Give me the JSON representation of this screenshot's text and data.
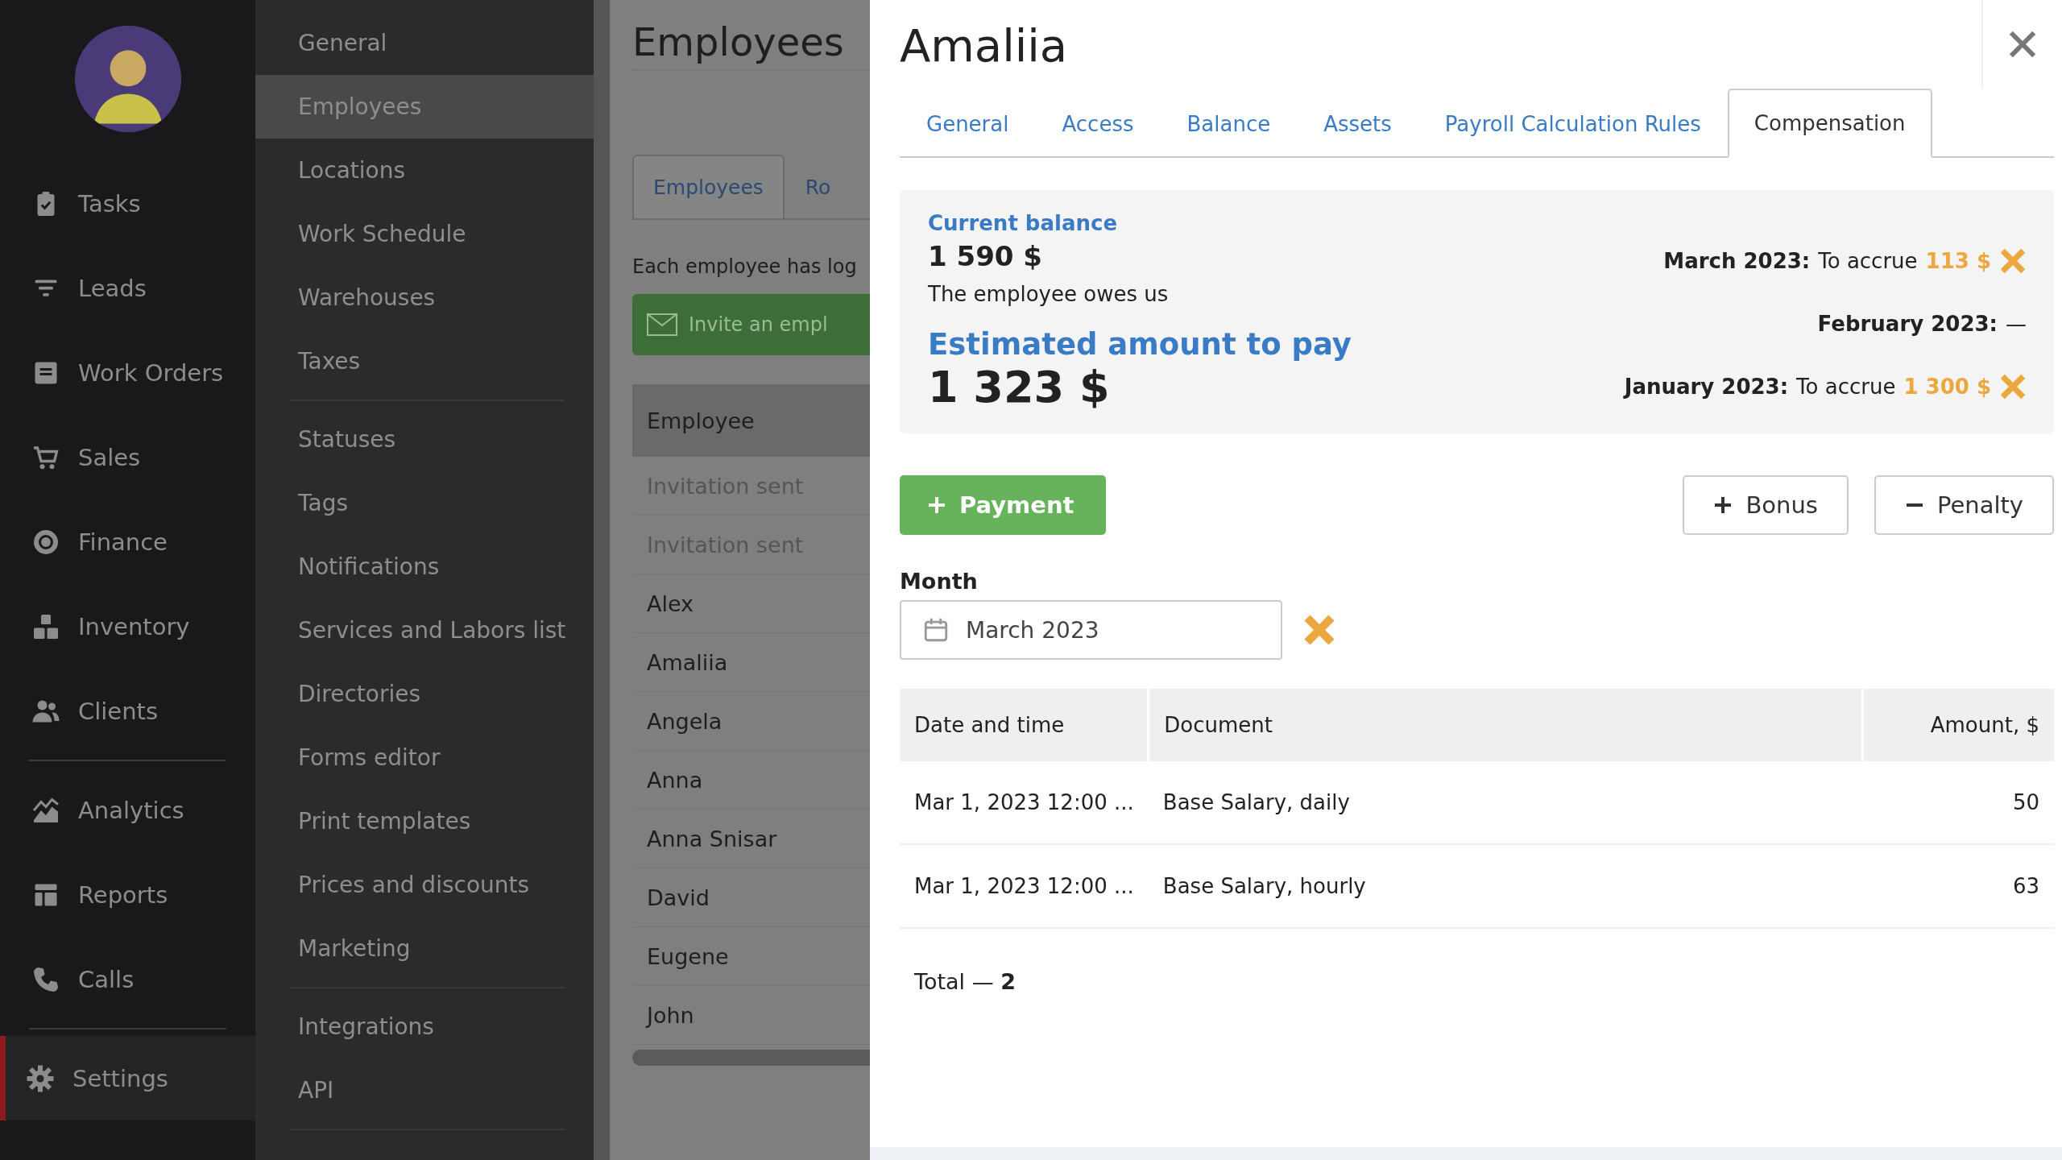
{
  "nav": {
    "groups": [
      [
        {
          "label": "Tasks",
          "selected": false
        },
        {
          "label": "Leads",
          "selected": false
        },
        {
          "label": "Work Orders",
          "selected": false
        },
        {
          "label": "Sales",
          "selected": false
        },
        {
          "label": "Finance",
          "selected": false
        },
        {
          "label": "Inventory",
          "selected": false
        },
        {
          "label": "Clients",
          "selected": false
        }
      ],
      [
        {
          "label": "Analytics",
          "selected": false
        },
        {
          "label": "Reports",
          "selected": false
        },
        {
          "label": "Calls",
          "selected": false
        }
      ],
      [
        {
          "label": "Settings",
          "selected": true
        }
      ]
    ]
  },
  "settings_menu": {
    "groups": [
      [
        {
          "label": "General",
          "selected": false
        },
        {
          "label": "Employees",
          "selected": true
        },
        {
          "label": "Locations",
          "selected": false
        },
        {
          "label": "Work Schedule",
          "selected": false
        },
        {
          "label": "Warehouses",
          "selected": false
        },
        {
          "label": "Taxes",
          "selected": false
        }
      ],
      [
        {
          "label": "Statuses",
          "selected": false
        },
        {
          "label": "Tags",
          "selected": false
        },
        {
          "label": "Notifications",
          "selected": false
        },
        {
          "label": "Services and Labors list",
          "selected": false
        },
        {
          "label": "Directories",
          "selected": false
        },
        {
          "label": "Forms editor",
          "selected": false
        },
        {
          "label": "Print templates",
          "selected": false
        },
        {
          "label": "Prices and discounts",
          "selected": false
        },
        {
          "label": "Marketing",
          "selected": false
        }
      ],
      [
        {
          "label": "Integrations",
          "selected": false
        },
        {
          "label": "API",
          "selected": false
        }
      ]
    ]
  },
  "background_page": {
    "title": "Employees",
    "tabs": [
      {
        "label": "Employees",
        "selected": true
      },
      {
        "label": "Ro",
        "selected": false
      }
    ],
    "description": "Each employee has log",
    "invite_button": "Invite an empl",
    "table": {
      "column": "Employee",
      "rows": [
        {
          "name": "Invitation sent",
          "kind": "invited"
        },
        {
          "name": "Invitation sent",
          "kind": "invited"
        },
        {
          "name": "Alex",
          "kind": "member"
        },
        {
          "name": "Amaliia",
          "kind": "member"
        },
        {
          "name": "Angela",
          "kind": "member"
        },
        {
          "name": "Anna",
          "kind": "member"
        },
        {
          "name": "Anna Snisar",
          "kind": "member"
        },
        {
          "name": "David",
          "kind": "member"
        },
        {
          "name": "Eugene",
          "kind": "member"
        },
        {
          "name": "John",
          "kind": "member"
        }
      ]
    }
  },
  "panel": {
    "title": "Amaliia",
    "tabs": [
      {
        "label": "General",
        "selected": false
      },
      {
        "label": "Access",
        "selected": false
      },
      {
        "label": "Balance",
        "selected": false
      },
      {
        "label": "Assets",
        "selected": false
      },
      {
        "label": "Payroll Calculation Rules",
        "selected": false
      },
      {
        "label": "Compensation",
        "selected": true
      }
    ],
    "balance": {
      "label": "Current balance",
      "value": "1 590 $",
      "note": "The employee owes us",
      "estimated_label": "Estimated amount to pay",
      "estimated_value": "1 323 $",
      "months": [
        {
          "month": "March 2023:",
          "text": "To accrue",
          "amount": "113 $"
        },
        {
          "month": "February 2023:",
          "text": "—"
        },
        {
          "month": "January 2023:",
          "text": "To accrue",
          "amount": "1 300 $"
        }
      ]
    },
    "buttons": {
      "payment": "Payment",
      "bonus": "Bonus",
      "penalty": "Penalty"
    },
    "month_field": {
      "label": "Month",
      "value": "March 2023"
    },
    "table": {
      "columns": [
        "Date and time",
        "Document",
        "Amount, $"
      ],
      "rows": [
        [
          "Mar 1, 2023 12:00 ...",
          "Base Salary, daily",
          "50"
        ],
        [
          "Mar 1, 2023 12:00 ...",
          "Base Salary, hourly",
          "63"
        ]
      ]
    },
    "total": "Total — **2**"
  }
}
